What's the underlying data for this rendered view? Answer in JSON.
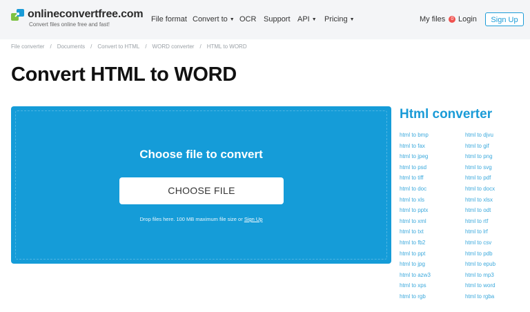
{
  "header": {
    "logo_title": "onlineconvertfree.com",
    "logo_subtitle": "Convert files online free and fast!",
    "nav": [
      {
        "label": "File format",
        "dropdown": false
      },
      {
        "label": "Convert to",
        "dropdown": true
      },
      {
        "label": "OCR",
        "dropdown": false
      },
      {
        "label": "Support",
        "dropdown": false
      },
      {
        "label": "API",
        "dropdown": true
      },
      {
        "label": "Pricing",
        "dropdown": true
      }
    ],
    "my_files_label": "My files",
    "my_files_count": "0",
    "login_label": "Login",
    "signup_label": "Sign Up"
  },
  "breadcrumb": [
    "File converter",
    "Documents",
    "Convert to HTML",
    "WORD converter",
    "HTML to WORD"
  ],
  "page_title": "Convert HTML to WORD",
  "upload": {
    "title": "Choose file to convert",
    "button_label": "CHOOSE FILE",
    "note": "Drop files here. 100 MB maximum file size or ",
    "note_link": "Sign Up"
  },
  "sidebar": {
    "title": "Html converter",
    "left_links": [
      "html to bmp",
      "html to fax",
      "html to jpeg",
      "html to psd",
      "html to tiff",
      "html to doc",
      "html to xls",
      "html to pptx",
      "html to xml",
      "html to txt",
      "html to fb2",
      "html to ppt",
      "html to jpg",
      "html to azw3",
      "html to xps",
      "html to rgb"
    ],
    "right_links": [
      "html to djvu",
      "html to gif",
      "html to png",
      "html to svg",
      "html to pdf",
      "html to docx",
      "html to xlsx",
      "html to odt",
      "html to rtf",
      "html to lrf",
      "html to csv",
      "html to pdb",
      "html to epub",
      "html to mp3",
      "html to word",
      "html to rgba"
    ]
  },
  "colors": {
    "accent": "#159cd8",
    "link": "#3aa8dc",
    "badge": "#f0524f"
  }
}
